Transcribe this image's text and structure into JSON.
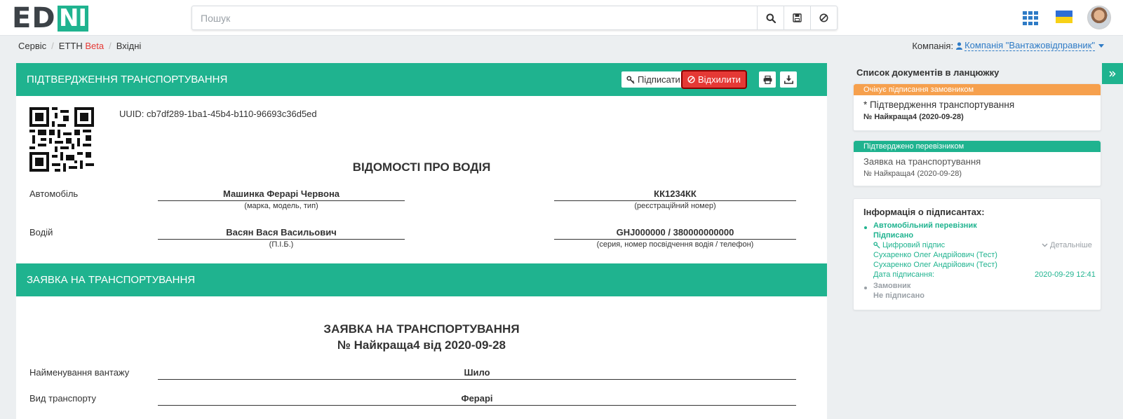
{
  "brand": {
    "part1": "ED",
    "part2": "NI"
  },
  "search": {
    "placeholder": "Пошук"
  },
  "breadcrumb": {
    "item1": "Сервіс",
    "item2": "ЕТТН",
    "item2_badge": "Beta",
    "item3": "Вхідні"
  },
  "company": {
    "label": "Компанія:",
    "value": "Компанія \"Вантажовідправник\""
  },
  "section1": {
    "header": "ПІДТВЕРДЖЕННЯ ТРАНСПОРТУВАННЯ",
    "sign_label": "Підписати",
    "reject_label": "Відхилити",
    "uuid": "UUID: cb7df289-1ba1-45b4-b110-96693c36d5ed",
    "title": "ВІДОМОСТІ ПРО ВОДІЯ",
    "car_label": "Автомобіль",
    "car_value": "Машинка Ферарі Червона",
    "car_hint": "(марка, модель, тип)",
    "plate_value": "КК1234КК",
    "plate_hint": "(реєстраційний номер)",
    "driver_label": "Водій",
    "driver_value": "Васян Вася Васильович",
    "driver_hint": "(П.І.Б.)",
    "license_value": "GHJ000000 / 380000000000",
    "license_hint": "(серия, номер посвідчення водія / телефон)"
  },
  "section2": {
    "header": "ЗАЯВКА НА ТРАНСПОРТУВАННЯ",
    "title_line1": "ЗАЯВКА НА ТРАНСПОРТУВАННЯ",
    "title_line2": "№ Найкраща4 від 2020-09-28",
    "cargo_label": "Найменування вантажу",
    "cargo_value": "Шило",
    "transport_label": "Вид транспорту",
    "transport_value": "Ферарі"
  },
  "sidebar": {
    "title": "Список документів в ланцюжку",
    "doc1": {
      "status": "Очікує підписання замовником",
      "title": "* Підтвердження транспортування",
      "number": "№ Найкраща4 (2020-09-28)"
    },
    "doc2": {
      "status": "Підтверджено перевізником",
      "title": "Заявка на транспортування",
      "number": "№ Найкраща4 (2020-09-28)"
    },
    "signers": {
      "title": "Інформація о підписантах:",
      "s1_role": "Автомобільний перевізник",
      "s1_state": "Підписано",
      "s1_type": "Цифровий підпис",
      "s1_details": "Детальніше",
      "s1_name1": "Сухаренко Олег Андрійович (Тест)",
      "s1_name2": "Сухаренко Олег Андрійович (Тест)",
      "s1_date_label": "Дата підписання:",
      "s1_date": "2020-09-29 12:41",
      "s2_role": "Замовник",
      "s2_state": "Не підписано"
    }
  },
  "colors": {
    "accent": "#1fb38f",
    "danger": "#e53935",
    "link": "#2e7bc6",
    "warning": "#f6a04d"
  },
  "icons": [
    "search-icon",
    "save-icon",
    "cancel-icon",
    "apps-grid-icon",
    "ukraine-flag-icon",
    "user-avatar",
    "key-icon",
    "ban-icon",
    "print-icon",
    "download-icon",
    "user-icon",
    "chevron-down-icon",
    "chevron-double-right-icon"
  ]
}
